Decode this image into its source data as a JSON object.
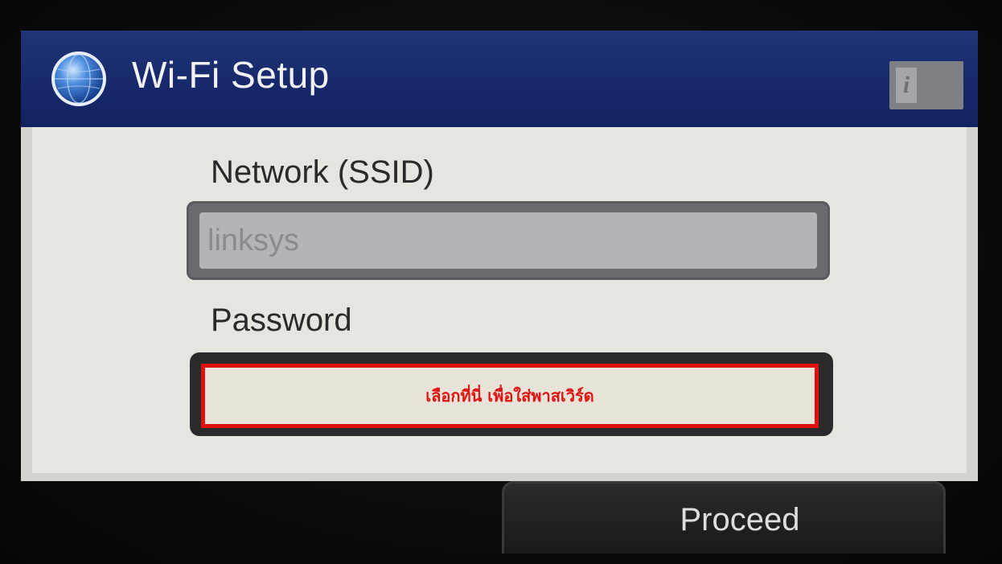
{
  "header": {
    "title": "Wi-Fi Setup",
    "globe_icon": "globe-icon",
    "info_icon": "info-icon",
    "info_label": "i",
    "bar_color": "#16286a"
  },
  "form": {
    "ssid_label": "Network (SSID)",
    "ssid_value": "linksys",
    "password_label": "Password",
    "password_hint": "เลือกที่นี่ เพื่อใส่พาสเวิร์ด",
    "highlight_color": "#e11010"
  },
  "footer": {
    "proceed_label": "Proceed"
  }
}
